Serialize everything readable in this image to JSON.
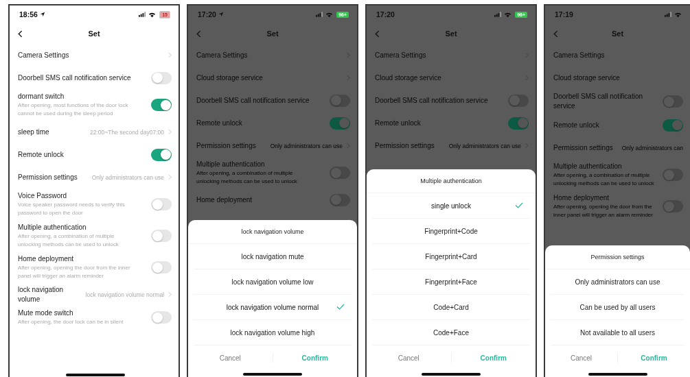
{
  "phones": [
    {
      "time": "18:56",
      "location": true,
      "battery": {
        "label": "15",
        "low": true
      },
      "title": "Set",
      "dimmed": false,
      "rows": [
        {
          "kind": "link",
          "label": "Camera Settings",
          "chevron": true
        },
        {
          "kind": "toggle",
          "label": "Doorbell SMS call notification service",
          "on": false
        },
        {
          "kind": "toggle",
          "label": "dormant switch",
          "description": "After opening, most functions of the door lock cannot be used during the sleep period",
          "on": true
        },
        {
          "kind": "value",
          "label": "sleep time",
          "value": "22:00~The second day07:00",
          "chevron": true
        },
        {
          "kind": "toggle",
          "label": "Remote unlock",
          "on": true
        },
        {
          "kind": "value",
          "label": "Permission settings",
          "value": "Only administrators can use",
          "chevron": true
        },
        {
          "kind": "toggle",
          "label": "Voice Password",
          "description": "Voice speaker password needs to verify this password to open the door",
          "on": false
        },
        {
          "kind": "toggle",
          "label": "Multiple authentication",
          "description": "After opening, a combination of multiple unlocking methods can be used to unlock",
          "on": false
        },
        {
          "kind": "toggle",
          "label": "Home deployment",
          "description": "After opening, opening the door from the inner panel will trigger an alarm reminder",
          "on": false
        },
        {
          "kind": "value",
          "label": "lock navigation volume",
          "value": "lock navigation volume normal",
          "chevron": true
        },
        {
          "kind": "toggle",
          "label": "Mute mode switch",
          "description": "After opening, the door lock can be in silent",
          "on": false
        }
      ]
    },
    {
      "time": "17:20",
      "location": true,
      "battery": {
        "label": "96+",
        "low": false
      },
      "title": "Set",
      "dimmed": true,
      "rows": [
        {
          "kind": "link",
          "label": "Camera Settings",
          "chevron": true
        },
        {
          "kind": "link",
          "label": "Cloud storage service",
          "chevron": true
        },
        {
          "kind": "toggle",
          "label": "Doorbell SMS call notification service",
          "on": false
        },
        {
          "kind": "toggle",
          "label": "Remote unlock",
          "on": true
        },
        {
          "kind": "value",
          "label": "Permission settings",
          "value": "Only administrators can use",
          "chevron": true
        },
        {
          "kind": "toggle",
          "label": "Multiple authentication",
          "description": "After opening, a combination of multiple unlocking methods can be used to unlock",
          "on": false
        },
        {
          "kind": "toggle",
          "label": "Home deployment",
          "on": false
        }
      ],
      "sheet": {
        "title": "lock navigation volume",
        "options": [
          {
            "label": "lock navigation mute",
            "selected": false
          },
          {
            "label": "lock navigation volume low",
            "selected": false
          },
          {
            "label": "lock navigation volume normal",
            "selected": true
          },
          {
            "label": "lock navigation volume high",
            "selected": false
          }
        ],
        "cancel": "Cancel",
        "confirm": "Confirm"
      }
    },
    {
      "time": "17:20",
      "location": false,
      "battery": {
        "label": "96+",
        "low": false
      },
      "title": "Set",
      "dimmed": true,
      "rows": [
        {
          "kind": "link",
          "label": "Camera Settings",
          "chevron": true
        },
        {
          "kind": "link",
          "label": "Cloud storage service",
          "chevron": true
        },
        {
          "kind": "toggle",
          "label": "Doorbell SMS call notification service",
          "on": false
        },
        {
          "kind": "toggle",
          "label": "Remote unlock",
          "on": true
        },
        {
          "kind": "value",
          "label": "Permission settings",
          "value": "Only administrators can use",
          "chevron": true
        }
      ],
      "sheet": {
        "title": "Multiple authentication",
        "options": [
          {
            "label": "single unlock",
            "selected": true
          },
          {
            "label": "Fingerprint+Code",
            "selected": false
          },
          {
            "label": "Fingerprint+Card",
            "selected": false
          },
          {
            "label": "Fingerprint+Face",
            "selected": false
          },
          {
            "label": "Code+Card",
            "selected": false
          },
          {
            "label": "Code+Face",
            "selected": false
          }
        ],
        "cancel": "Cancel",
        "confirm": "Confirm"
      }
    },
    {
      "time": "17:19",
      "location": false,
      "title": "Set",
      "dimmed": true,
      "rows": [
        {
          "kind": "link",
          "label": "Camera Settings",
          "chevron": false
        },
        {
          "kind": "link",
          "label": "Cloud storage service",
          "chevron": false
        },
        {
          "kind": "toggle",
          "label": "Doorbell SMS call notification service",
          "on": false
        },
        {
          "kind": "toggle",
          "label": "Remote unlock",
          "on": true
        },
        {
          "kind": "value",
          "label": "Permission settings",
          "value": "Only administrators can",
          "chevron": false
        },
        {
          "kind": "toggle",
          "label": "Multiple authentication",
          "description": "After opening, a combination of multiple unlocking methods can be used to unlock",
          "on": false
        },
        {
          "kind": "toggle",
          "label": "Home deployment",
          "description": "After opening, opening the door from the inner panel will trigger an alarm reminder",
          "on": false
        }
      ],
      "sheet": {
        "title": "Permission settings",
        "options": [
          {
            "label": "Only administrators can use",
            "selected": false
          },
          {
            "label": "Can be used by all users",
            "selected": false
          },
          {
            "label": "Not available to all users",
            "selected": false
          }
        ],
        "cancel": "Cancel",
        "confirm": "Confirm"
      }
    }
  ]
}
